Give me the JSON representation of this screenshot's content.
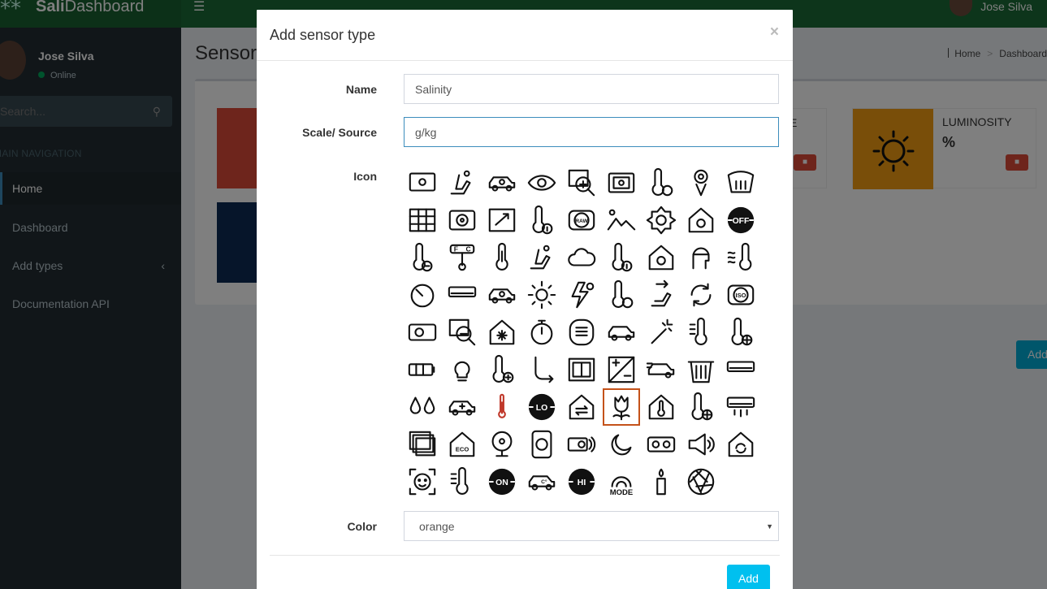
{
  "app": {
    "logo_bold": "Sali",
    "logo_rest": "Dashboard"
  },
  "header": {
    "user_name": "Jose Silva"
  },
  "sidebar": {
    "user_name": "Jose Silva",
    "status": "Online",
    "search_placeholder": "Search...",
    "nav_header": "MAIN NAVIGATION",
    "items": [
      {
        "label": "Home",
        "active": true
      },
      {
        "label": "Dashboard"
      },
      {
        "label": "Add types"
      },
      {
        "label": "Documentation API"
      }
    ]
  },
  "page": {
    "title": "Sensor types",
    "breadcrumb": [
      "Home",
      "Dashboard"
    ],
    "cards": [
      {
        "title": "LUMINOSITY",
        "unit": "%",
        "color": "#f39c12"
      }
    ],
    "add_button": "Add"
  },
  "modal": {
    "title": "Add sensor type",
    "name_label": "Name",
    "name_value": "Salinity",
    "scale_label": "Scale/ Source",
    "scale_value": "g/kg",
    "icon_label": "Icon",
    "selected_icon": "tulip-icon",
    "color_label": "Color",
    "color_value": "orange",
    "add_label": "Add",
    "close_symbol": "×"
  },
  "icons": [
    "projector-screen-icon",
    "car-seat-heater-icon",
    "car-fan-icon",
    "eye-scan-icon",
    "zoom-image-icon",
    "camera-frame-icon",
    "thermometer-celsius-icon",
    "person-pin-icon",
    "windshield-defrost-icon",
    "map-grid-icon",
    "fan-panel-icon",
    "image-expand-icon",
    "thermometer-info-icon",
    "raw-format-icon",
    "landscape-icon",
    "sun-frame-icon",
    "smart-home-fan-icon",
    "off-button-icon",
    "thermometer-low-icon",
    "thermometer-dual-scale-icon",
    "thermometer-icon",
    "seat-recline-icon",
    "cloud-icon",
    "thermometer-fahrenheit-icon",
    "home-sun-icon",
    "person-profile-icon",
    "heat-waves-thermometer-icon",
    "timer-icon",
    "air-conditioner-icon",
    "car-cycle-icon",
    "sun-icon",
    "power-lightning-icon",
    "thermometer-fahrenheit-alt-icon",
    "seat-forward-icon",
    "refresh-icon",
    "iso-button-icon",
    "heater-icon",
    "zoom-minus-icon",
    "home-snowflake-icon",
    "stopwatch-icon",
    "radiator-icon",
    "car-icon",
    "magic-wand-icon",
    "thermometer-thin-icon",
    "thermometer-snow-icon",
    "battery-icon",
    "light-bulb-icon",
    "thermometer-plus-icon",
    "hook-arrow-icon",
    "window-heater-icon",
    "exposure-icon",
    "car-wind-icon",
    "trash-bin-icon",
    "wall-ac-icon",
    "water-drops-icon",
    "car-game-icon",
    "red-thermometer-icon",
    "lo-button-icon",
    "home-transfer-icon",
    "tulip-icon",
    "home-thermometer-icon",
    "thermometer-snowflake-icon",
    "ac-airflow-icon",
    "photo-stack-icon",
    "eco-home-icon",
    "table-fan-icon",
    "speaker-fan-icon",
    "projector-sound-icon",
    "night-cloud-icon",
    "video-camera-icon",
    "loudspeaker-icon",
    "home-refresh-icon",
    "face-scan-icon",
    "thermometer-scale-icon",
    "on-button-icon",
    "car-celsius-icon",
    "hi-button-icon",
    "mode-button-icon",
    "candle-icon",
    "aperture-icon"
  ]
}
